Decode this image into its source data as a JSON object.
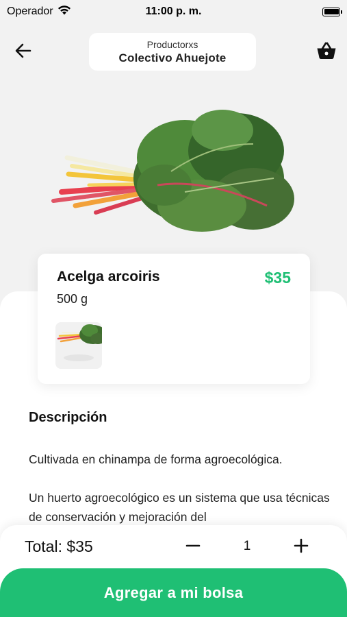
{
  "status_bar": {
    "carrier": "Operador",
    "time": "11:00 p. m.",
    "wifi_icon": "wifi-icon",
    "battery_icon": "battery-icon"
  },
  "header": {
    "back_icon": "arrow-left-icon",
    "producer_label": "Productorxs",
    "producer_name": "Colectivo Ahuejote",
    "basket_icon": "basket-icon"
  },
  "product": {
    "name": "Acelga arcoiris",
    "price": "$35",
    "weight": "500 g",
    "image": "rainbow-chard-image"
  },
  "description": {
    "title": "Descripción",
    "paragraph_1": "Cultivada en chinampa de forma agroecológica.",
    "paragraph_2": "Un huerto agroecológico es un sistema que usa técnicas de conservación y mejoración del"
  },
  "cart": {
    "total_label": "Total: $35",
    "quantity": "1",
    "minus_icon": "minus-icon",
    "plus_icon": "plus-icon",
    "add_button_label": "Agregar a mi bolsa"
  },
  "colors": {
    "accent": "#1fbf74",
    "background": "#f2f2f2"
  }
}
